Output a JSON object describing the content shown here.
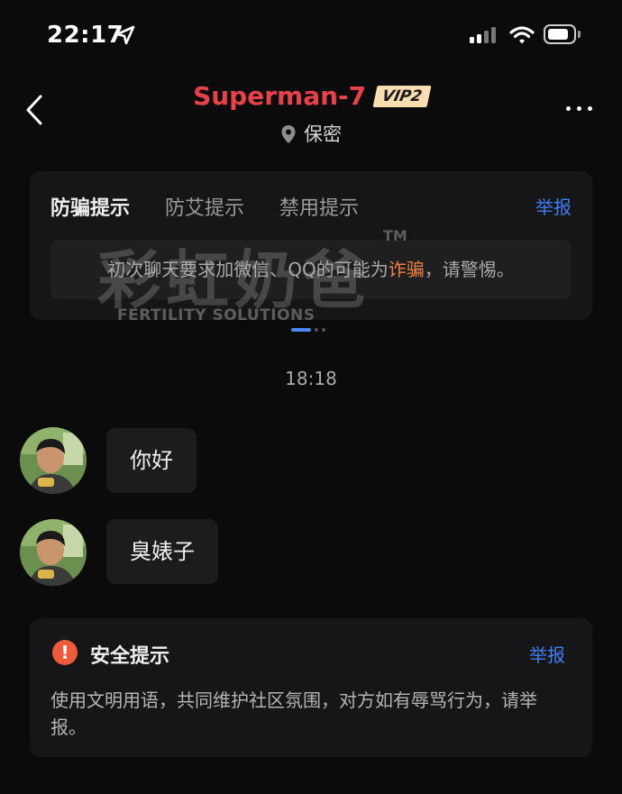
{
  "status_bar": {
    "time": "22:17"
  },
  "header": {
    "name": "Superman-7",
    "vip_badge": "VIP2",
    "location": "保密"
  },
  "tips_card": {
    "tabs": [
      "防骗提示",
      "防艾提示",
      "禁用提示"
    ],
    "active_tab": 0,
    "report_label": "举报",
    "message_before": "初次聊天要求加微信、QQ的可能为",
    "message_highlight": "诈骗",
    "message_after": "，请警惕。"
  },
  "watermark": {
    "main": "彩虹奶爸",
    "tm": "TM",
    "sub": "FERTILITY SOLUTIONS"
  },
  "chat": {
    "timestamp": "18:18",
    "messages": [
      {
        "text": "你好"
      },
      {
        "text": "臭婊子"
      }
    ]
  },
  "safety_card": {
    "icon": "!",
    "title": "安全提示",
    "report_label": "举报",
    "body": "使用文明用语，共同维护社区氛围，对方如有辱骂行为，请举报。"
  },
  "colors": {
    "background": "#0b0b0c",
    "name": "#e8414a",
    "link": "#3f7ef0",
    "warning": "#f0823b"
  }
}
